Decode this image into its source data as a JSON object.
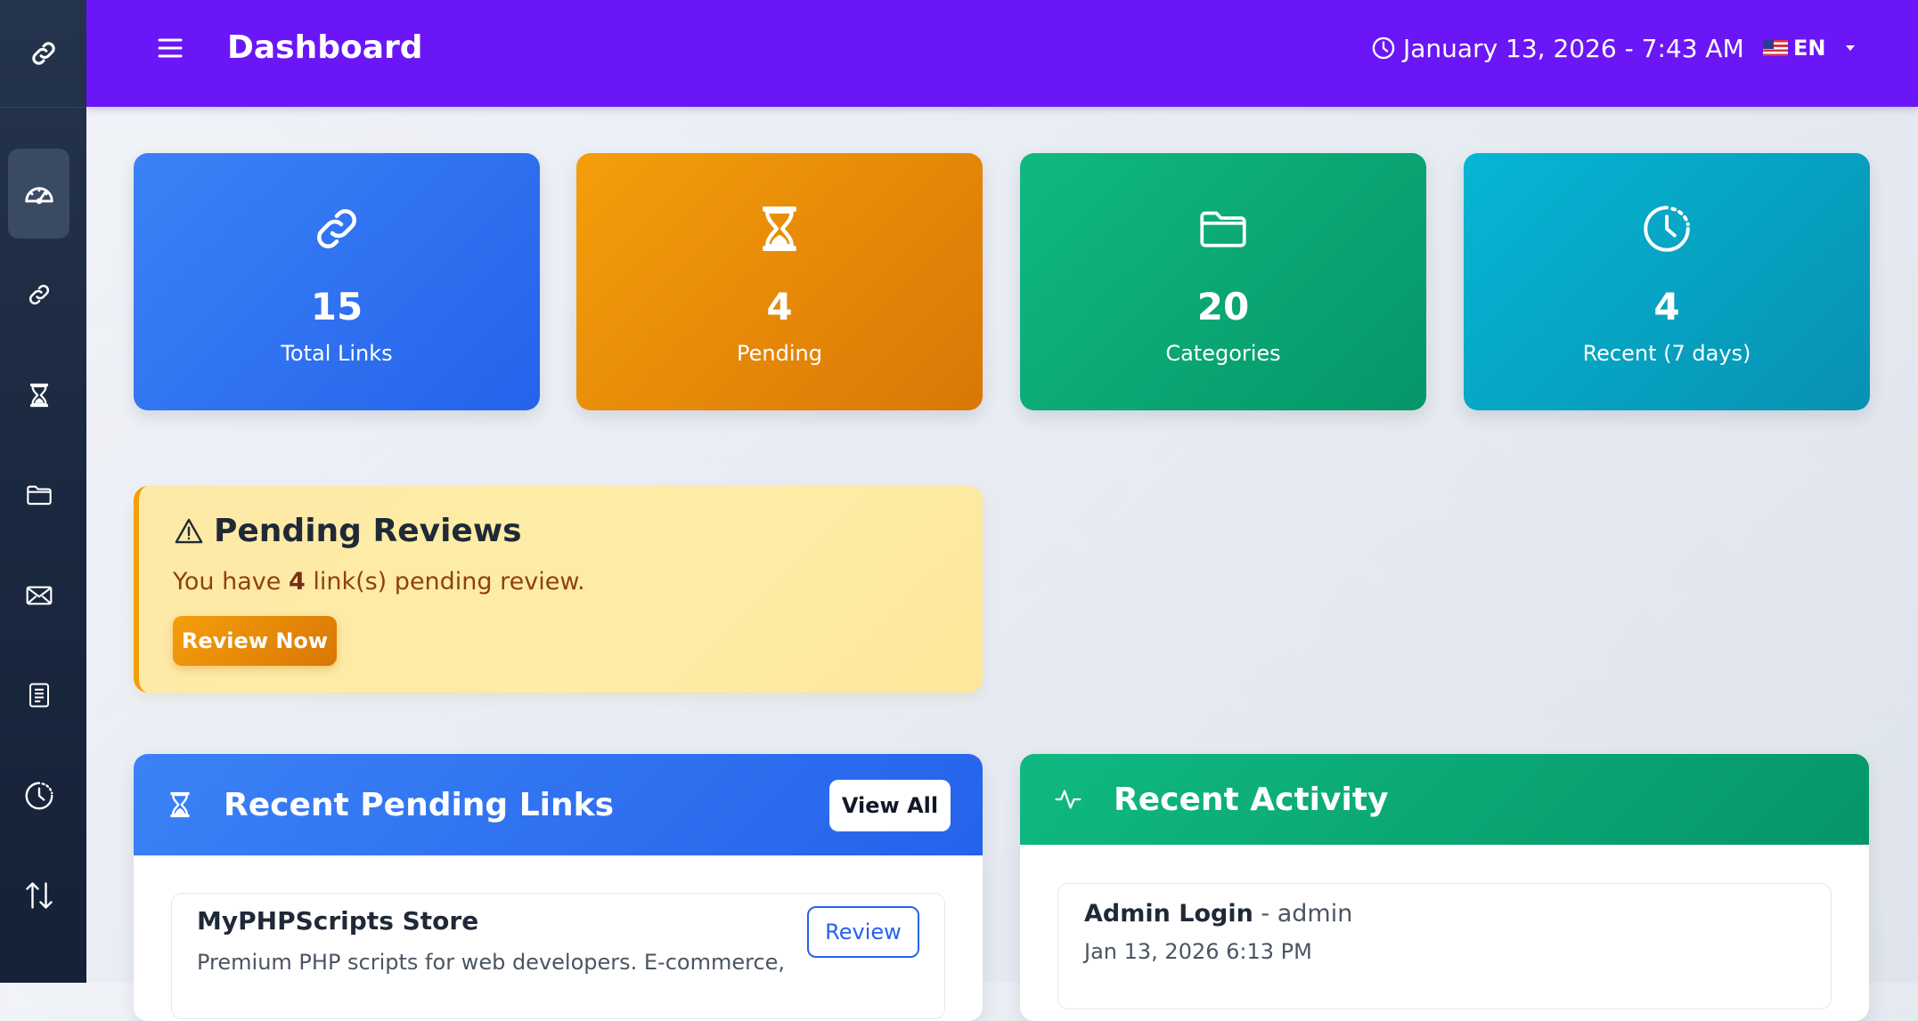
{
  "header": {
    "title": "Dashboard",
    "datetime": "January 13, 2026 - 7:43 AM",
    "language": "EN"
  },
  "sidebar": {
    "items": [
      {
        "icon": "link-icon",
        "label": ""
      },
      {
        "icon": "speedometer-icon",
        "active": true
      },
      {
        "icon": "link-icon"
      },
      {
        "icon": "hourglass-icon"
      },
      {
        "icon": "folder-icon"
      },
      {
        "icon": "envelope-icon"
      },
      {
        "icon": "document-icon"
      },
      {
        "icon": "clock-history-icon"
      },
      {
        "icon": "sort-arrows-icon"
      }
    ]
  },
  "stats": [
    {
      "value": "15",
      "label": "Total Links",
      "icon": "link-icon",
      "color": "#3b82f6"
    },
    {
      "value": "4",
      "label": "Pending",
      "icon": "hourglass-icon",
      "color": "#f59e0b"
    },
    {
      "value": "20",
      "label": "Categories",
      "icon": "folder-icon",
      "color": "#10b981"
    },
    {
      "value": "4",
      "label": "Recent (7 days)",
      "icon": "clock-history-icon",
      "color": "#06b6d4"
    }
  ],
  "alert": {
    "title": "Pending Reviews",
    "text_before": "You have ",
    "count": "4",
    "text_after": " link(s) pending review.",
    "button": "Review Now"
  },
  "pending_panel": {
    "title": "Recent Pending Links",
    "view_all": "View All",
    "items": [
      {
        "name": "MyPHPScripts Store",
        "description": "Premium PHP scripts for web developers. E-commerce,",
        "button": "Review"
      }
    ]
  },
  "activity_panel": {
    "title": "Recent Activity",
    "items": [
      {
        "action": "Admin Login",
        "separator": " - ",
        "user": "admin",
        "time": "Jan 13, 2026 6:13 PM"
      }
    ]
  }
}
